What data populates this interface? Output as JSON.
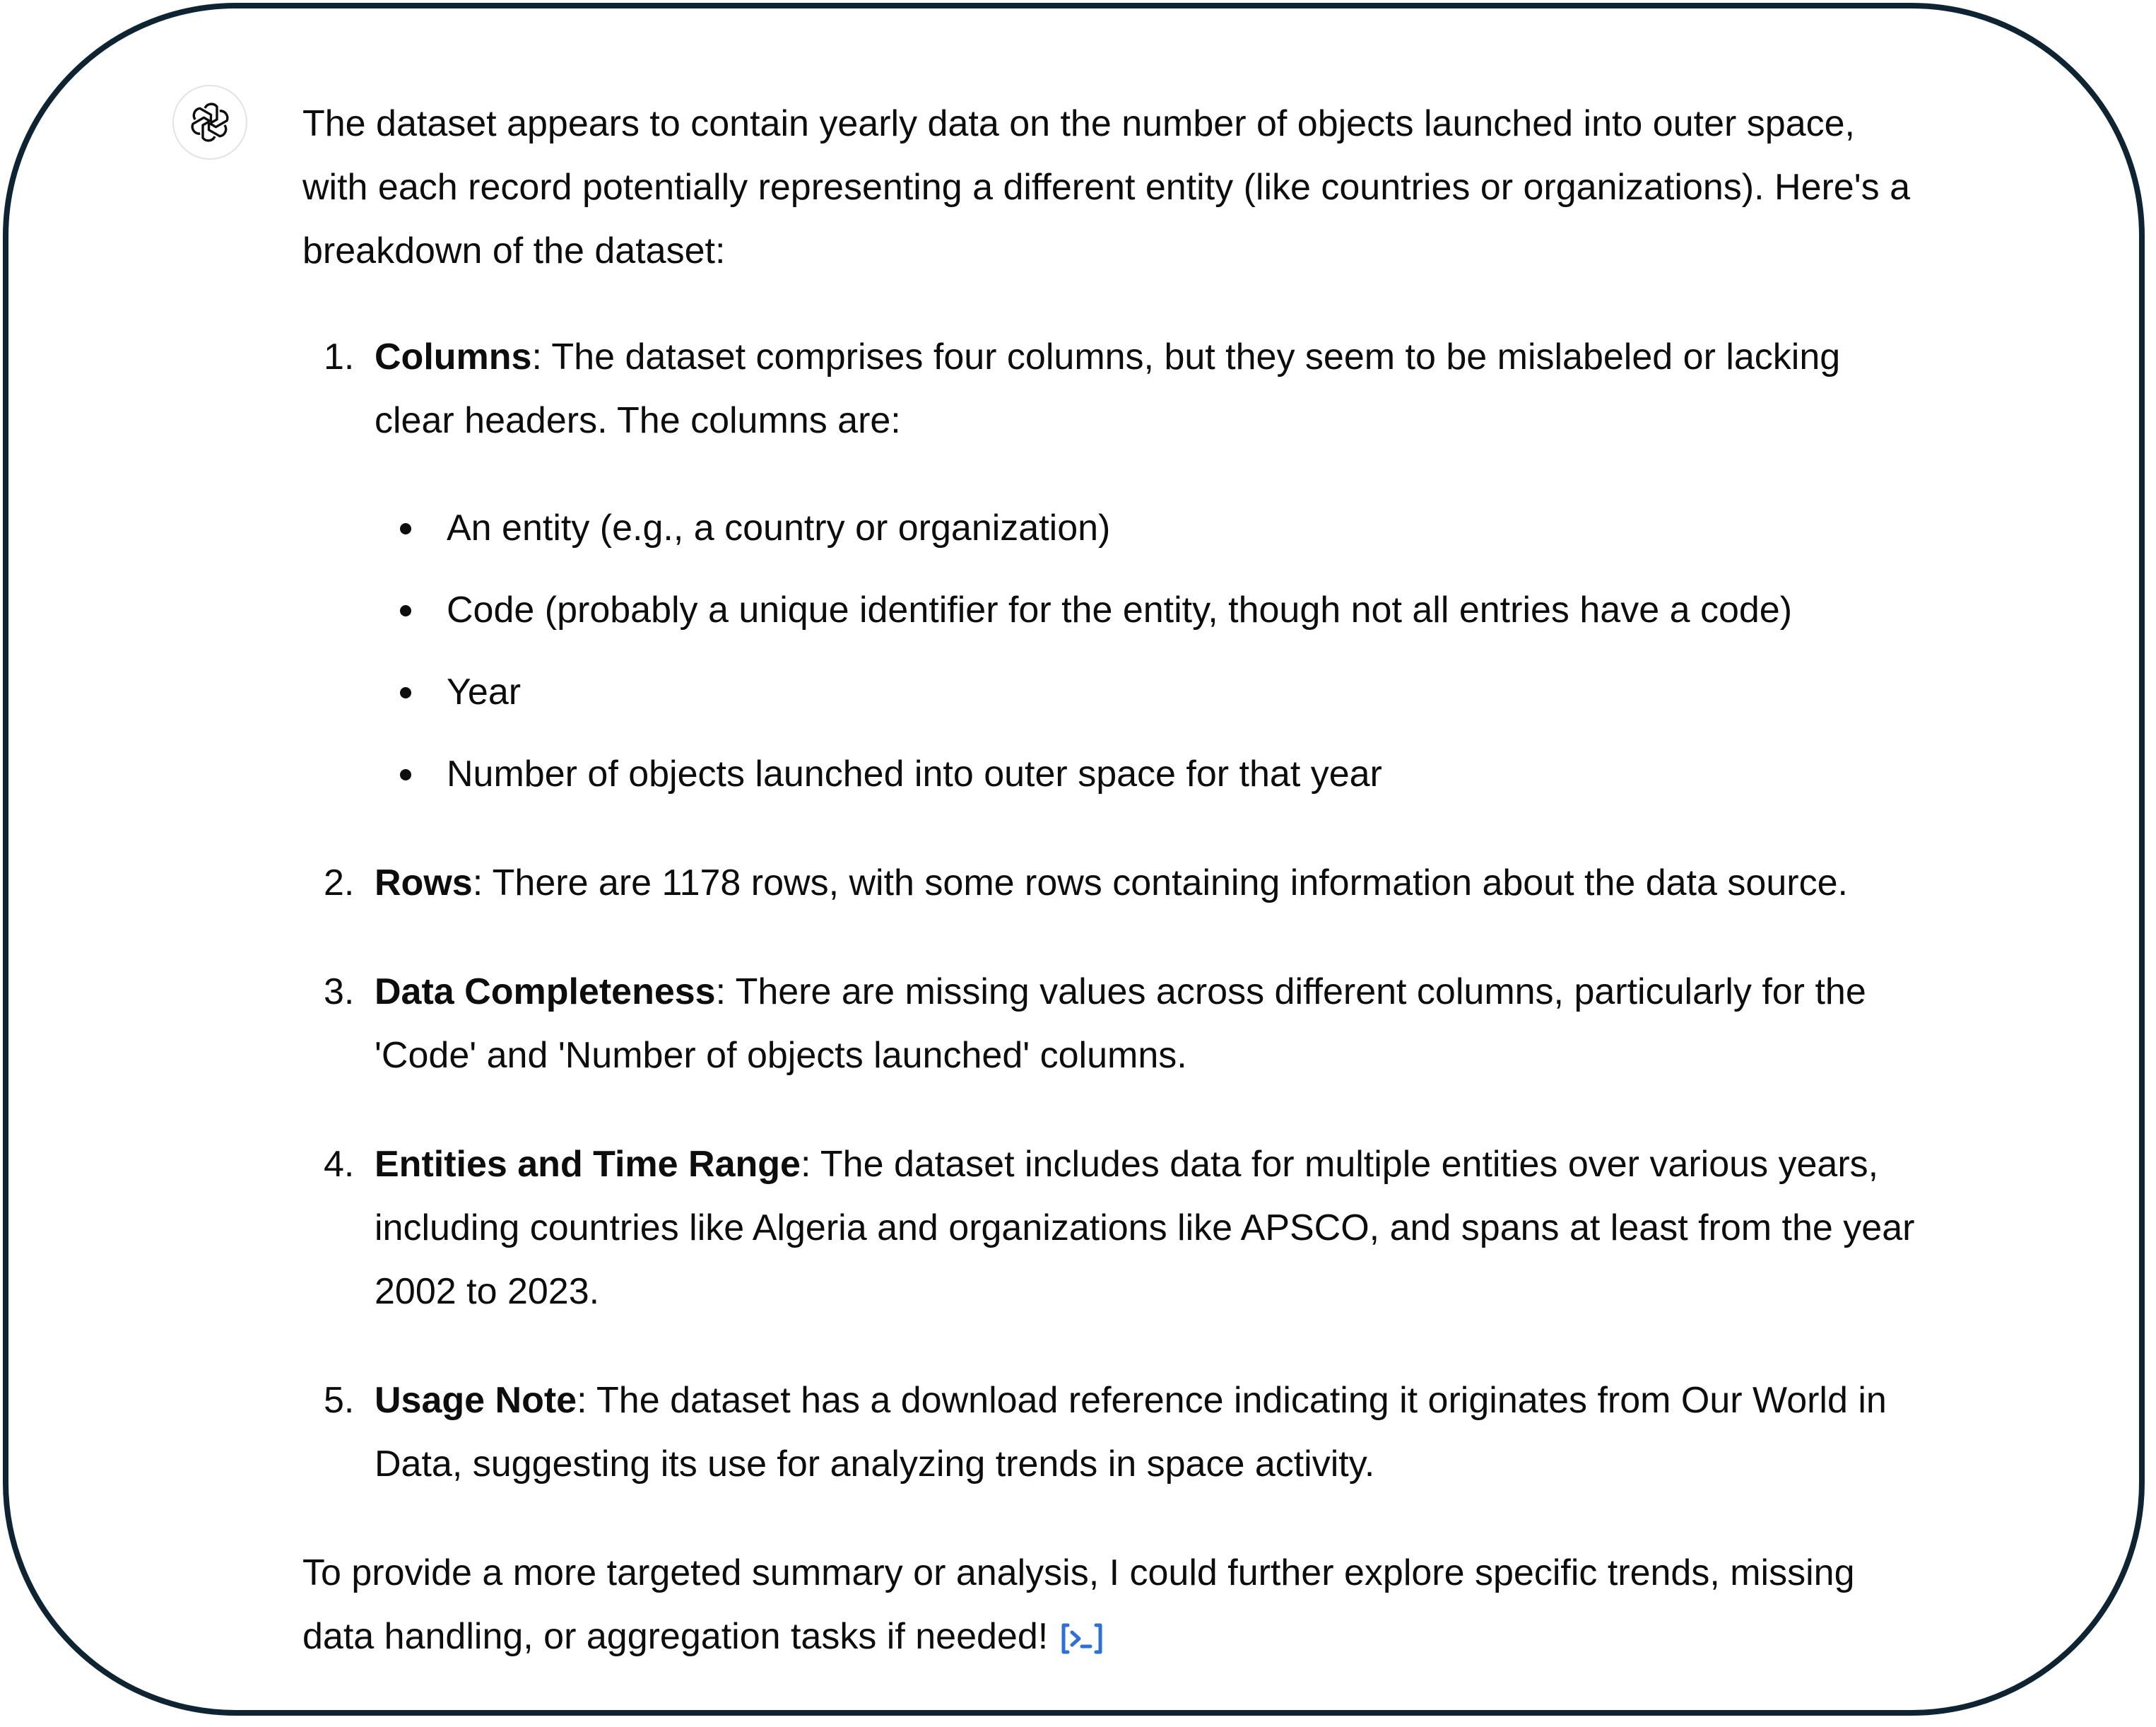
{
  "colors": {
    "frame_border": "#0f2433",
    "text": "#0d0d0d",
    "link_accent": "#2f6fd6"
  },
  "assistant_avatar_icon": "openai-logo-icon",
  "intro": "The dataset appears to contain yearly data on the number of objects launched into outer space, with each record potentially representing a different entity (like countries or organizations). Here's a breakdown of the dataset:",
  "points": [
    {
      "title": "Columns",
      "text": ": The dataset comprises four columns, but they seem to be mislabeled or lacking clear headers. The columns are:",
      "bullets": [
        "An entity (e.g., a country or organization)",
        "Code (probably a unique identifier for the entity, though not all entries have a code)",
        "Year",
        "Number of objects launched into outer space for that year"
      ]
    },
    {
      "title": "Rows",
      "text": ": There are 1178 rows, with some rows containing information about the data source."
    },
    {
      "title": "Data Completeness",
      "text": ": There are missing values across different columns, particularly for the 'Code' and 'Number of objects launched' columns."
    },
    {
      "title": "Entities and Time Range",
      "text": ": The dataset includes data for multiple entities over various years, including countries like Algeria and organizations like APSCO, and spans at least from the year 2002 to 2023."
    },
    {
      "title": "Usage Note",
      "text": ": The dataset has a download reference indicating it originates from Our World in Data, suggesting its use for analyzing trends in space activity."
    }
  ],
  "closing": "To provide a more targeted summary or analysis, I could further explore specific trends, missing data handling, or aggregation tasks if needed!",
  "code_link_icon": "view-code-icon"
}
